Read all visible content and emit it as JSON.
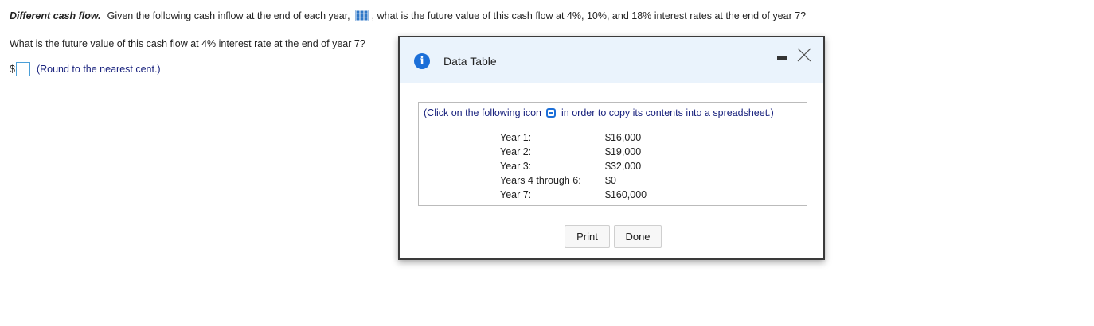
{
  "question": {
    "title": "Different cash flow.",
    "text_before_icon": "Given the following cash inflow at the end of each year,",
    "table_icon": "table-grid-icon",
    "text_after_icon": ", what is the future value of this cash flow at 4%, 10%, and 18% interest rates at the end of year 7?"
  },
  "sub_question": "What is the future value of this cash flow at 4% interest rate at the end of year 7?",
  "answer": {
    "currency": "$",
    "value": "",
    "hint": "(Round to the nearest cent.)"
  },
  "modal": {
    "title": "Data Table",
    "icons": [
      "info-icon",
      "minimize-icon",
      "close-icon"
    ],
    "copy_note_before": "(Click on the following icon",
    "copy_icon": "copy-spreadsheet-icon",
    "copy_note_after": "in order to copy its contents into a spreadsheet.)",
    "rows": [
      {
        "label": "Year 1:",
        "value": "$16,000"
      },
      {
        "label": "Year 2:",
        "value": "$19,000"
      },
      {
        "label": "Year 3:",
        "value": "$32,000"
      },
      {
        "label": "Years 4 through 6:",
        "value": "$0"
      },
      {
        "label": "Year 7:",
        "value": "$160,000"
      }
    ],
    "print_label": "Print",
    "done_label": "Done"
  },
  "colors": {
    "accent": "#1c6fd8",
    "header_bg": "#eaf3fc",
    "hint_text": "#1a237e"
  }
}
